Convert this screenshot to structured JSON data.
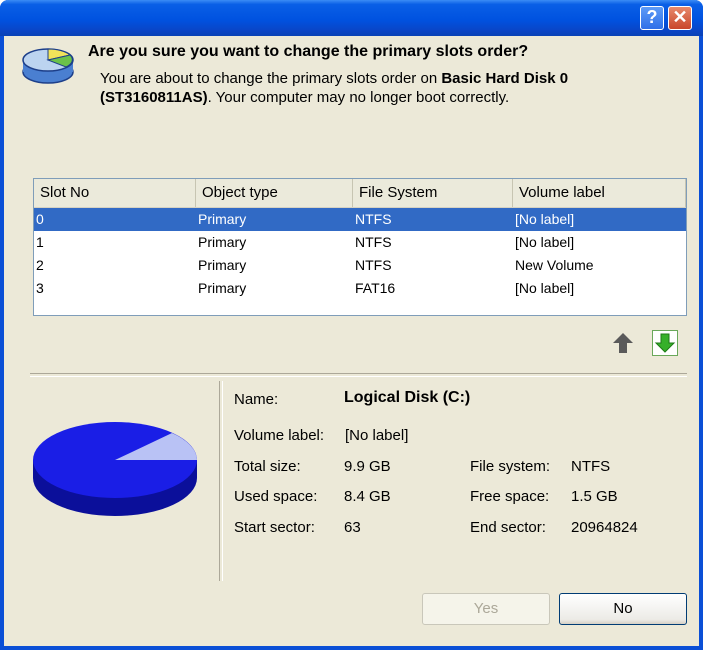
{
  "window": {
    "help_glyph": "?",
    "close_glyph": "✕"
  },
  "question": {
    "title": "Are you sure you want to change the primary slots order?",
    "desc_line1_prefix": "You are about to change the primary slots order on ",
    "desc_disk": "Basic Hard Disk 0",
    "desc_model": "(ST3160811AS)",
    "desc_line2_suffix": ". Your computer may no longer boot correctly."
  },
  "table": {
    "columns": [
      "Slot No",
      "Object type",
      "File System",
      "Volume label"
    ],
    "rows": [
      {
        "slot": "0",
        "type": "Primary",
        "fs": "NTFS",
        "label": "[No label]",
        "selected": true
      },
      {
        "slot": "1",
        "type": "Primary",
        "fs": "NTFS",
        "label": "[No label]",
        "selected": false
      },
      {
        "slot": "2",
        "type": "Primary",
        "fs": "NTFS",
        "label": "New Volume",
        "selected": false
      },
      {
        "slot": "3",
        "type": "Primary",
        "fs": "FAT16",
        "label": "[No label]",
        "selected": false
      }
    ]
  },
  "details": {
    "name_label": "Name:",
    "name_value": "Logical Disk (C:)",
    "volume_label_label": "Volume label:",
    "volume_label_value": "[No label]",
    "total_size_label": "Total size:",
    "total_size_value": "9.9 GB",
    "used_space_label": "Used space:",
    "used_space_value": "8.4 GB",
    "start_sector_label": "Start sector:",
    "start_sector_value": "63",
    "file_system_label": "File system:",
    "file_system_value": "NTFS",
    "free_space_label": "Free space:",
    "free_space_value": "1.5 GB",
    "end_sector_label": "End sector:",
    "end_sector_value": "20964824"
  },
  "buttons": {
    "yes": "Yes",
    "no": "No"
  },
  "colors": {
    "title_bar": "#0052e0",
    "selection": "#316ac5",
    "disk_blue": "#1a1ee6"
  }
}
